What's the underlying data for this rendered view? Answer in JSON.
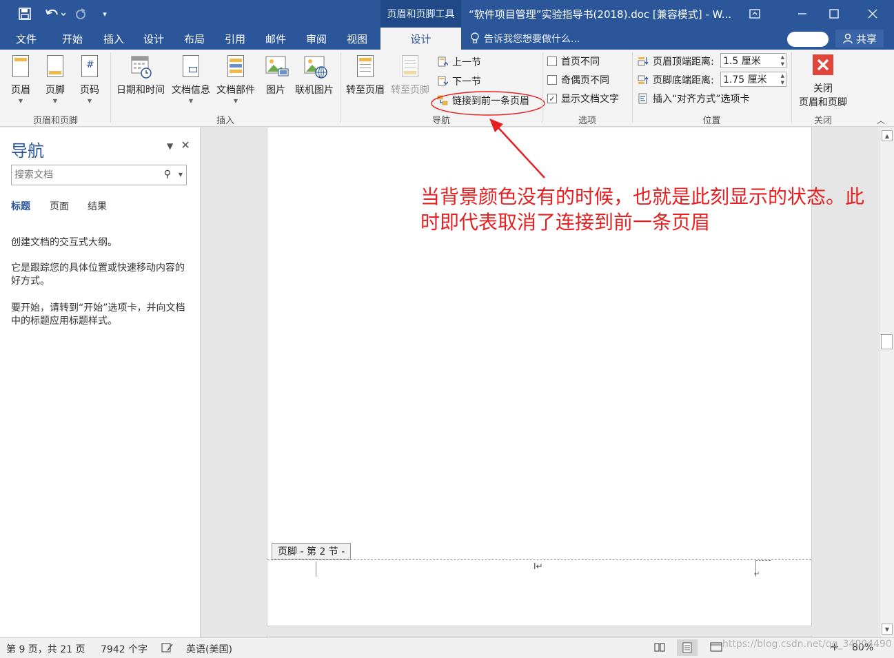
{
  "titlebar": {
    "context_tools": "页眉和页脚工具",
    "doc_title": "“软件项目管理”实验指导书(2018).doc [兼容模式] - W...",
    "save_icon": "save-icon",
    "undo_icon": "undo-icon",
    "redo_icon": "redo-icon"
  },
  "tabs": {
    "file": "文件",
    "home": "开始",
    "insert": "插入",
    "design": "设计",
    "layout": "布局",
    "references": "引用",
    "mailings": "邮件",
    "review": "审阅",
    "view": "视图",
    "hf_design": "设计",
    "tell_me": "告诉我您想要做什么...",
    "share": "共享"
  },
  "ribbon": {
    "header": "页眉",
    "footer": "页脚",
    "page_number": "页码",
    "group_header_footer": "页眉和页脚",
    "date_time": "日期和时间",
    "doc_info": "文档信息",
    "quick_parts": "文档部件",
    "pictures": "图片",
    "online_pictures": "联机图片",
    "group_insert": "插入",
    "goto_header": "转至页眉",
    "goto_footer": "转至页脚",
    "previous": "上一节",
    "next": "下一节",
    "link_previous": "链接到前一条页眉",
    "group_navigation": "导航",
    "diff_first": "首页不同",
    "diff_odd_even": "奇偶页不同",
    "show_doc_text": "显示文档文字",
    "show_doc_text_check": "✓",
    "group_options": "选项",
    "header_from_top_label": "页眉顶端距离:",
    "header_from_top_value": "1.5 厘米",
    "footer_from_bottom_label": "页脚底端距离:",
    "footer_from_bottom_value": "1.75 厘米",
    "insert_align_tab": "插入“对齐方式”选项卡",
    "group_position": "位置",
    "close_label_1": "关闭",
    "close_label_2": "页眉和页脚",
    "group_close": "关闭"
  },
  "nav": {
    "title": "导航",
    "search_placeholder": "搜索文档",
    "tab_headings": "标题",
    "tab_pages": "页面",
    "tab_results": "结果",
    "text1": "创建文档的交互式大纲。",
    "text2": "它是跟踪您的具体位置或快速移动内容的好方式。",
    "text3": "要开始，请转到“开始”选项卡，并向文档中的标题应用标题样式。"
  },
  "document": {
    "annotation_line1": "当背景颜色没有的时候，也就是此刻显示的状态。此",
    "annotation_line2": "时即代表取消了连接到前一条页眉",
    "footer_tag": "页脚 - 第 2 节 -"
  },
  "status": {
    "page": "第 9 页，共 21 页",
    "words": "7942 个字",
    "language": "英语(美国)",
    "zoom": "80%",
    "watermark": "https://blog.csdn.net/qq_34004490"
  },
  "colors": {
    "accent": "#2b579a",
    "annotation": "#e62020",
    "close_button": "#e0453a"
  }
}
